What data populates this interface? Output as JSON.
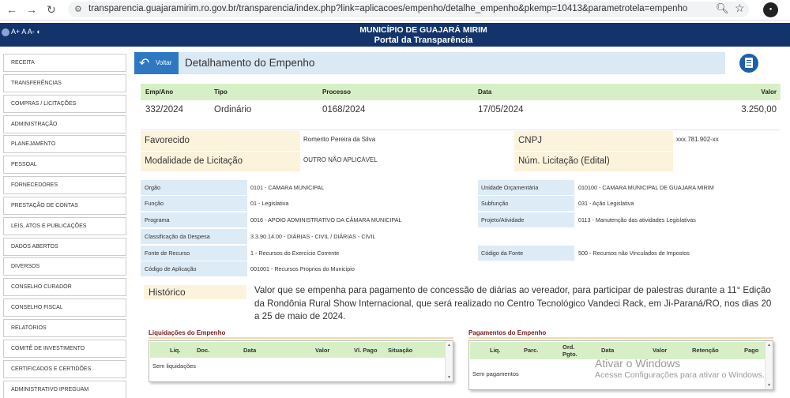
{
  "browser": {
    "back": "←",
    "forward": "→",
    "reload": "↻",
    "url": "transparencia.guajaramirim.ro.gov.br/transparencia/index.php?link=aplicacoes/empenho/detalhe_empenho&pkemp=10413&parametrotela=empenho"
  },
  "site": {
    "title_line1": "MUNICÍPIO DE GUAJARÁ MIRIM",
    "title_line2": "Portal da Transparência",
    "accessibility": "A+ A A-"
  },
  "sidebar": {
    "items": [
      {
        "label": "RECEITA"
      },
      {
        "label": "TRANSFERÊNCIAS"
      },
      {
        "label": "COMPRAS / LICITAÇÕES"
      },
      {
        "label": "ADMINISTRAÇÃO"
      },
      {
        "label": "PLANEJAMENTO"
      },
      {
        "label": "PESSOAL"
      },
      {
        "label": "FORNECEDORES"
      },
      {
        "label": "PRESTAÇÃO DE CONTAS"
      },
      {
        "label": "LEIS, ATOS E PUBLICAÇÕES"
      },
      {
        "label": "DADOS ABERTOS"
      },
      {
        "label": "DIVERSOS"
      },
      {
        "label": "CONSELHO CURADOR"
      },
      {
        "label": "CONSELHO FISCAL"
      },
      {
        "label": "RELATÓRIOS"
      },
      {
        "label": "COMITÊ DE INVESTIMENTO"
      },
      {
        "label": "CERTIFICADOS E CERTIDÕES"
      },
      {
        "label": "ADMINISTRATIVO IPREGUAM"
      }
    ]
  },
  "page": {
    "back_label": "Voltar",
    "title": "Detalhamento do Empenho"
  },
  "summary": {
    "headers": {
      "emp_ano": "Emp/Ano",
      "tipo": "Tipo",
      "processo": "Processo",
      "data": "Data",
      "valor": "Valor"
    },
    "values": {
      "emp_ano": "332/2024",
      "tipo": "Ordinário",
      "processo": "0168/2024",
      "data": "17/05/2024",
      "valor": "3.250,00"
    }
  },
  "favorecido": {
    "label": "Favorecido",
    "value": "Romerito Pereira da Silva",
    "cnpj_label": "CNPJ",
    "cnpj_value": "xxx.781.902-xx",
    "modalidade_label": "Modalidade de Licitação",
    "modalidade_value": "OUTRO NÃO APLICÁVEL",
    "num_licitacao_label": "Núm. Licitação (Edital)",
    "num_licitacao_value": ""
  },
  "details": {
    "orgao_label": "Orgão",
    "orgao_value": "0101 - CAMARA MUNICIPAL",
    "unidade_label": "Unidade Orçamentária",
    "unidade_value": "010100 - CAMARA MUNICIPAL DE GUAJARA MIRIM",
    "funcao_label": "Função",
    "funcao_value": "01 - Legislativa",
    "subfuncao_label": "Subfunção",
    "subfuncao_value": "031 - Ação Legislativa",
    "programa_label": "Programa",
    "programa_value": "0016 - APOIO ADMINISTRATIVO DA CÂMARA MUNICIPAL",
    "projeto_label": "Projeto/Atividade",
    "projeto_value": "0113 - Manutenção das atividades Legislativas",
    "classificacao_label": "Classificação da Despesa",
    "classificacao_value": "3.3.90.14.00 - DIÁRIAS - CIVIL / DIÁRIAS - CIVIL",
    "fonte_label": "Fonte de Recurso",
    "fonte_value": "1 - Recursos do Exercício Corrente",
    "codfonte_label": "Código da Fonte",
    "codfonte_value": "500 - Recursos não Vinculados de Impostos",
    "codaplic_label": "Código de Aplicação",
    "codaplic_value": "001001 - Recursos Proprios do Municipio"
  },
  "historico": {
    "label": "Histórico",
    "text": "Valor que se empenha para pagamento de concessão de diárias ao vereador, para participar de palestras durante a 11° Edição da Rondônia Rural Show Internacional, que será realizado no Centro Tecnológico Vandeci Rack, em Ji-Paraná/RO, nos dias 20 a 25 de maio de 2024."
  },
  "liquidacoes": {
    "title": "Liquidações do Empenho",
    "headers": {
      "liq": "Liq.",
      "doc": "Doc.",
      "data": "Data",
      "valor": "Valor",
      "vl_pago": "Vl. Pago",
      "situacao": "Situação"
    },
    "empty": "Sem liquidações"
  },
  "pagamentos": {
    "title": "Pagamentos do Empenho",
    "headers": {
      "liq": "Liq.",
      "parc": "Parc.",
      "ord": "Ord.",
      "pgto": "Pgto.",
      "data": "Data",
      "valor": "Valor",
      "retencao": "Retenção",
      "pago": "Pago"
    },
    "empty": "Sem pagamentos"
  },
  "watermark": {
    "line1": "Ativar o Windows",
    "line2": "Acesse Configurações para ativar o Windows."
  },
  "colors": {
    "header_bg": "#13346b",
    "back_button": "#2e78c2",
    "table_header": "#d7efc6",
    "label_yellow": "#fcf3dc",
    "label_blue": "#ddebf6"
  }
}
